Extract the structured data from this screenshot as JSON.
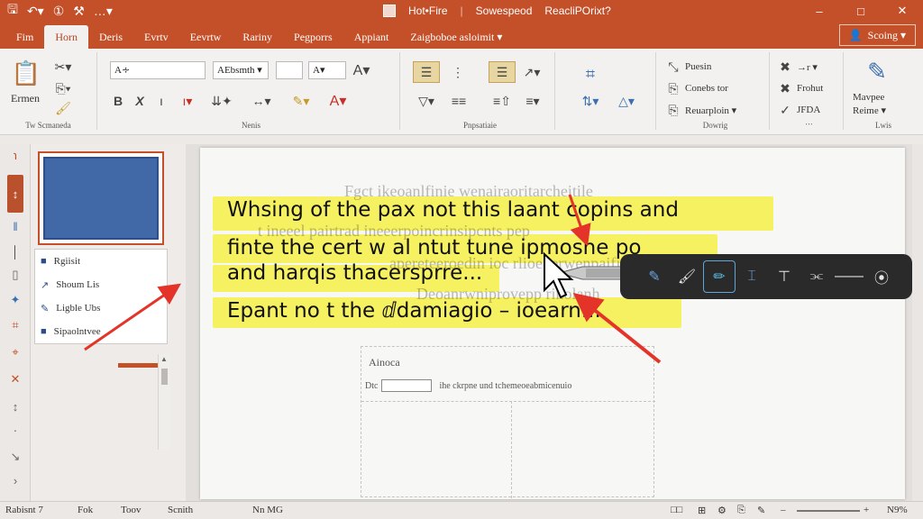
{
  "titlebar": {
    "file_name": "Hot•Fire",
    "mode": "Sowespeod",
    "app": "ReacliPOrixt?",
    "qat": [
      "save-icon",
      "undo-icon",
      "redo-icon",
      "brush-icon",
      "more-icon"
    ],
    "controls": [
      "minimize-icon",
      "restore-icon",
      "close-icon"
    ]
  },
  "tabs": [
    {
      "label": "Fim"
    },
    {
      "label": "Horn",
      "active": true
    },
    {
      "label": "Deris"
    },
    {
      "label": "Evrtv"
    },
    {
      "label": "Eevrtw"
    },
    {
      "label": "Rariny"
    },
    {
      "label": "Pegporrs"
    },
    {
      "label": "Appiant"
    },
    {
      "label": "Zaigboboe asloimit ▾"
    }
  ],
  "share": {
    "label": "Scoing ▾"
  },
  "ribbon": {
    "groups": [
      {
        "label": "Tw Scmaneda",
        "items": [
          "Ermen"
        ]
      },
      {
        "label": "Nenis",
        "font_name": "A∻",
        "font_face": "AEbsmth ▾",
        "font_size": "",
        "font_grow": "A▾"
      },
      {
        "label": "Pnpsatiaie"
      },
      {
        "label": "",
        "items": []
      },
      {
        "label": "Dowrig",
        "items": [
          "Puesin",
          "Conebs tor",
          "Reuarploin ▾"
        ]
      },
      {
        "label": "",
        "items": [
          "→r ▾",
          "Frohut",
          "JFDA"
        ]
      },
      {
        "label": "Lwis",
        "items": [
          "Mavpee",
          "Reime ▾"
        ]
      }
    ]
  },
  "thumbs": {
    "items": [
      {
        "label": "Rgiisit"
      },
      {
        "label": "Shoum Lis"
      },
      {
        "label": "Ligble Ubs"
      },
      {
        "label": "Sipaolntvee"
      }
    ]
  },
  "slide": {
    "ghost_lines": [
      "Fgct ikeoanlfinie wenairaoritarcheitile",
      "t ineeel pairtrad ineeerpoincrinsipcnts pep",
      "apereteeroedin ioc rlioe terwenpaifi.",
      "Deoanrwniprovepp rinolanh"
    ],
    "lines": [
      "Whsing of the pax not this laant copins and",
      "finte the cert w al ntut tune ipmosne po",
      "and harqis thacersprre...",
      "Epant no t the ⅆdamiagio – ioearn..."
    ],
    "placeholder": {
      "title": "Ainoca",
      "row_label": "Dtc",
      "row_text": "ihe ckrpne und tchemeoeabmicenuio"
    }
  },
  "pen_toolbar": {
    "tools": [
      "pen-icon",
      "brush-icon",
      "highlighter-icon",
      "select-text-icon",
      "insert-space-icon",
      "lasso-icon",
      "separator-icon",
      "settings-icon"
    ],
    "selected": 2
  },
  "statusbar": {
    "slide": "Rabisnt 7",
    "a": "Fok",
    "b": "Toov",
    "c": "Scnith",
    "d": "Nn MG",
    "zoom": "N9%"
  },
  "colors": {
    "accent": "#c4502a",
    "highlight": "#f6f046",
    "thumb_blue": "#4169a7",
    "arrow": "#e4342a"
  }
}
